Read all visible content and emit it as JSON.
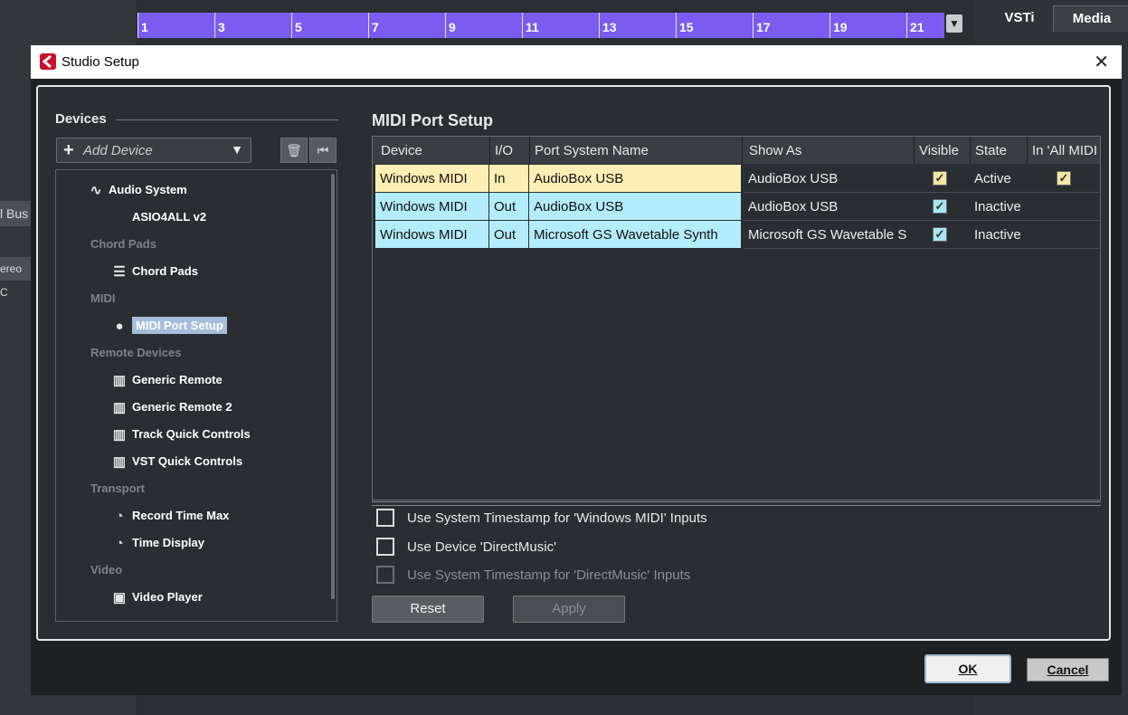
{
  "ruler": {
    "ticks": [
      "1",
      "3",
      "5",
      "7",
      "9",
      "11",
      "13",
      "15",
      "17",
      "19",
      "21"
    ]
  },
  "right_tabs": {
    "vsti": "VSTi",
    "media": "Media"
  },
  "bg_fragments": {
    "bus": "l Bus",
    "stereo": "ereo C"
  },
  "window": {
    "title": "Studio Setup",
    "close": "✕"
  },
  "devices": {
    "header": "Devices",
    "add_device": "Add Device",
    "tree": [
      {
        "type": "item",
        "label": "Audio System",
        "icon": "waveform-icon",
        "glyph": "∿",
        "indent": 0
      },
      {
        "type": "item",
        "label": "ASIO4ALL v2",
        "icon": "",
        "glyph": "",
        "indent": 1
      },
      {
        "type": "category",
        "label": "Chord Pads"
      },
      {
        "type": "item",
        "label": "Chord Pads",
        "icon": "chord-pads-icon",
        "glyph": "☰",
        "indent": 1
      },
      {
        "type": "category",
        "label": "MIDI"
      },
      {
        "type": "item",
        "label": "MIDI Port Setup",
        "icon": "midi-port-icon",
        "glyph": "●",
        "indent": 1,
        "selected": true
      },
      {
        "type": "category",
        "label": "Remote Devices"
      },
      {
        "type": "item",
        "label": "Generic Remote",
        "icon": "remote-device-icon",
        "glyph": "▥",
        "indent": 1
      },
      {
        "type": "item",
        "label": "Generic Remote 2",
        "icon": "remote-device-icon",
        "glyph": "▥",
        "indent": 1
      },
      {
        "type": "item",
        "label": "Track Quick Controls",
        "icon": "remote-device-icon",
        "glyph": "▥",
        "indent": 1
      },
      {
        "type": "item",
        "label": "VST Quick Controls",
        "icon": "remote-device-icon",
        "glyph": "▥",
        "indent": 1
      },
      {
        "type": "category",
        "label": "Transport"
      },
      {
        "type": "item",
        "label": "Record Time Max",
        "icon": "clock-icon",
        "glyph": "◔",
        "indent": 1
      },
      {
        "type": "item",
        "label": "Time Display",
        "icon": "clock-icon",
        "glyph": "◔",
        "indent": 1
      },
      {
        "type": "category",
        "label": "Video"
      },
      {
        "type": "item",
        "label": "Video Player",
        "icon": "film-icon",
        "glyph": "▣",
        "indent": 1
      }
    ]
  },
  "midi_setup": {
    "title": "MIDI Port Setup",
    "columns": [
      "Device",
      "I/O",
      "Port System Name",
      "Show As",
      "Visible",
      "State",
      "In 'All MIDI"
    ],
    "rows": [
      {
        "device": "Windows MIDI",
        "io": "In",
        "port": "AudioBox USB",
        "show_as": "AudioBox USB",
        "visible": true,
        "state": "Active",
        "all_midi": true,
        "highlight": "#fdefb3"
      },
      {
        "device": "Windows MIDI",
        "io": "Out",
        "port": "AudioBox USB",
        "show_as": "AudioBox USB",
        "visible": true,
        "state": "Inactive",
        "all_midi": false,
        "highlight": "#b3ecfa"
      },
      {
        "device": "Windows MIDI",
        "io": "Out",
        "port": "Microsoft GS Wavetable Synth",
        "show_as": "Microsoft GS Wavetable S",
        "visible": true,
        "state": "Inactive",
        "all_midi": false,
        "highlight": "#b3ecfa"
      }
    ],
    "options": [
      {
        "label": "Use System Timestamp for 'Windows MIDI' Inputs",
        "checked": false,
        "enabled": true
      },
      {
        "label": "Use Device 'DirectMusic'",
        "checked": false,
        "enabled": true
      },
      {
        "label": "Use System Timestamp for 'DirectMusic' Inputs",
        "checked": false,
        "enabled": false
      }
    ],
    "reset_label": "Reset",
    "apply_label": "Apply"
  },
  "footer": {
    "ok_label": "OK",
    "cancel_label": "Cancel"
  }
}
